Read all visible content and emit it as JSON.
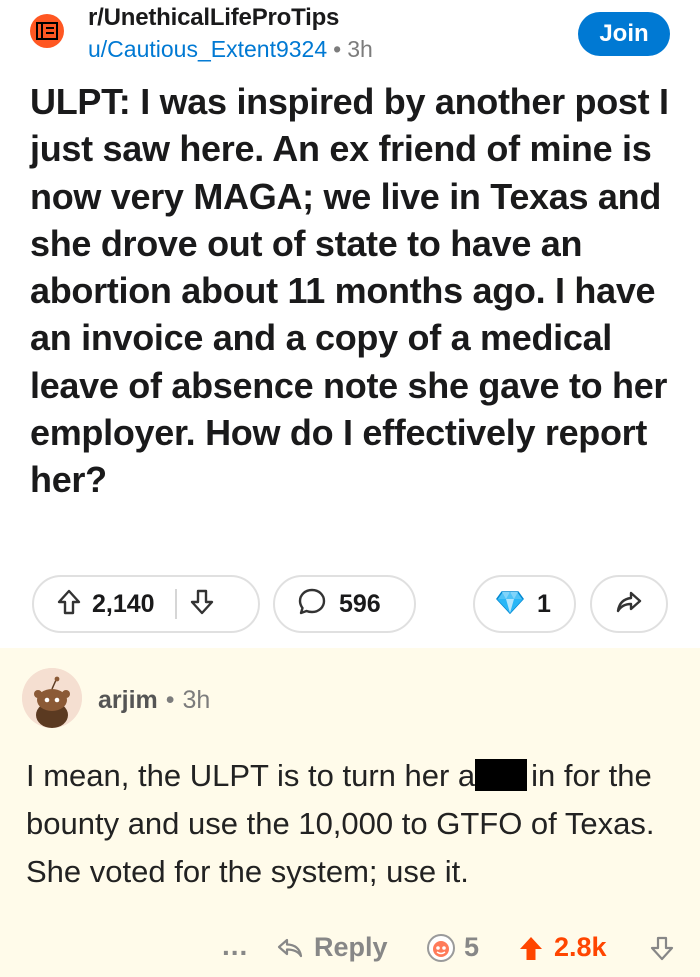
{
  "post": {
    "subreddit": "r/UnethicalLifeProTips",
    "author": "u/Cautious_Extent9324",
    "separator": "•",
    "age": "3h",
    "join_label": "Join",
    "title": "ULPT: I was inspired by another post I just saw here. An ex friend of mine is now very MAGA; we live in Texas and she drove out of state to have an abortion about 11 months ago. I have an invoice and a copy of a medical leave of absence note she gave to her employer. How do I effectively report her?",
    "upvotes": "2,140",
    "comments": "596",
    "awards": "1",
    "icons": [
      "subreddit-icon",
      "upvote-icon",
      "downvote-icon",
      "comment-icon",
      "award-icon",
      "share-icon"
    ]
  },
  "comment": {
    "author": "arjim",
    "separator": "•",
    "age": "3h",
    "body_part1": "I mean, the ULPT is to turn her a",
    "body_part2": "in for the bounty and use the 10,000 to GTFO of Texas.   She voted for the system; use it.",
    "more_label": "...",
    "reply_label": "Reply",
    "award_count": "5",
    "score": "2.8k",
    "score_color": "#ff4500",
    "icons": [
      "avatar-icon",
      "reply-icon",
      "award-icon",
      "upvote-icon",
      "downvote-icon"
    ]
  },
  "colors": {
    "accent": "#0079d3",
    "comment_bg": "#fffbea",
    "subreddit_icon": "#ff5722"
  }
}
